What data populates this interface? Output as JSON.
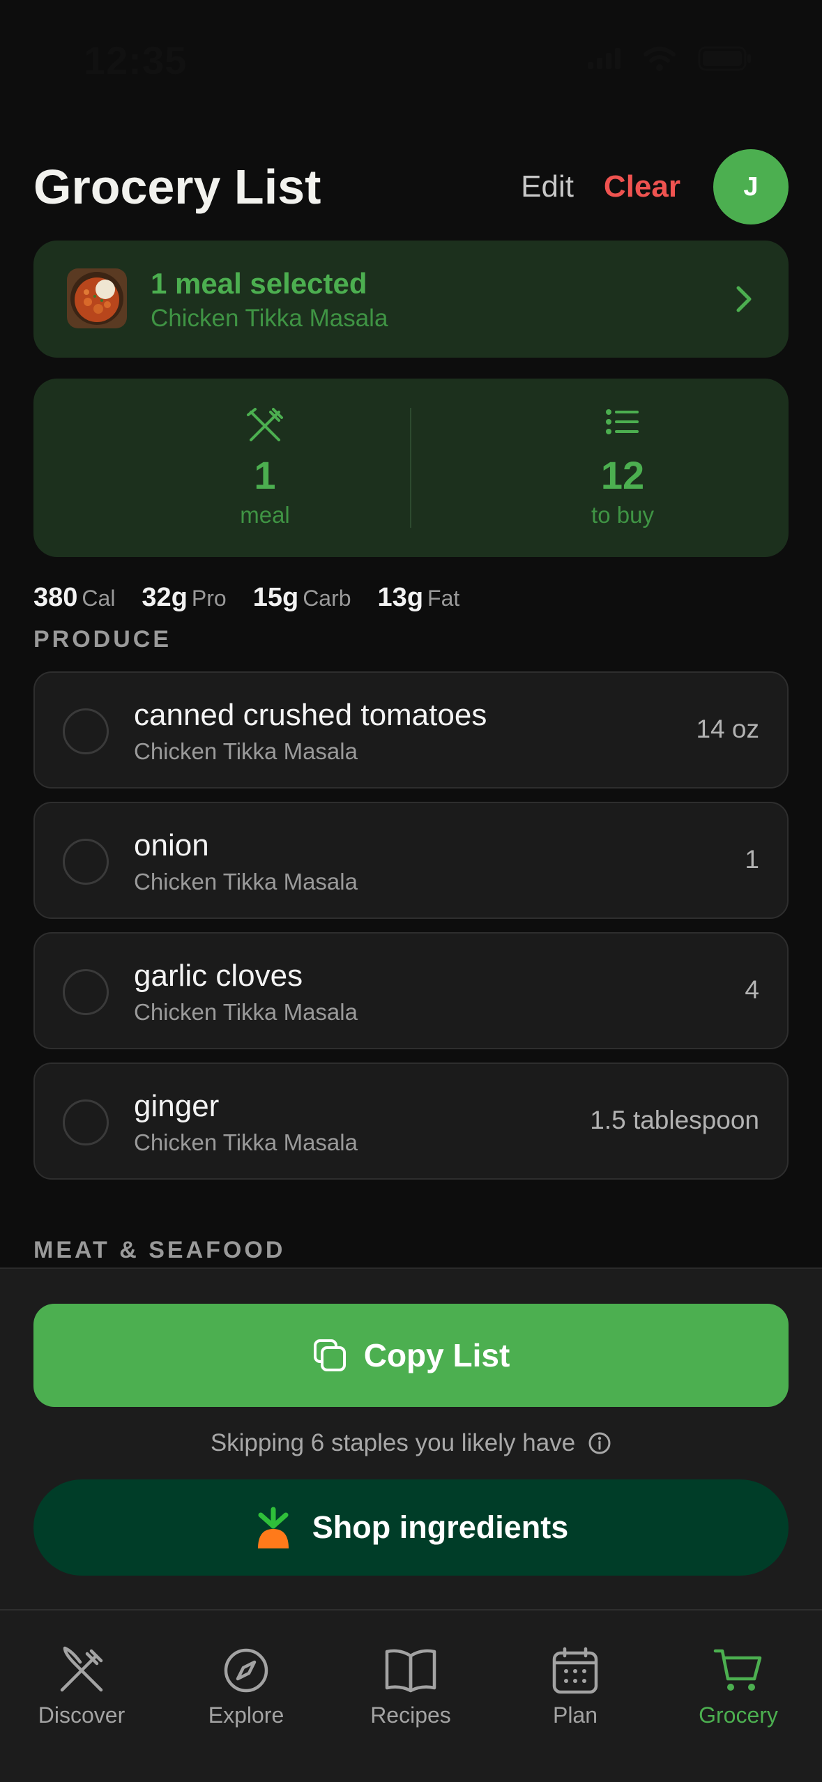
{
  "status_bar": {
    "time": "12:35"
  },
  "header": {
    "title": "Grocery List",
    "edit_label": "Edit",
    "clear_label": "Clear",
    "avatar_initial": "J"
  },
  "meal_selection": {
    "title": "1 meal selected",
    "meal_name": "Chicken Tikka Masala"
  },
  "stats": {
    "meals_value": "1",
    "meals_label": "meal",
    "to_buy_value": "12",
    "to_buy_label": "to buy"
  },
  "macros": [
    {
      "value": "380",
      "label": "Cal"
    },
    {
      "value": "32g",
      "label": "Pro"
    },
    {
      "value": "15g",
      "label": "Carb"
    },
    {
      "value": "13g",
      "label": "Fat"
    }
  ],
  "sections": [
    {
      "label": "PRODUCE",
      "items": [
        {
          "name": "canned crushed tomatoes",
          "recipe": "Chicken Tikka Masala",
          "quantity": "14 oz"
        },
        {
          "name": "onion",
          "recipe": "Chicken Tikka Masala",
          "quantity": "1"
        },
        {
          "name": "garlic cloves",
          "recipe": "Chicken Tikka Masala",
          "quantity": "4"
        },
        {
          "name": "ginger",
          "recipe": "Chicken Tikka Masala",
          "quantity": "1.5 tablespoon"
        }
      ]
    },
    {
      "label": "MEAT & SEAFOOD",
      "items": []
    }
  ],
  "actions": {
    "copy_label": "Copy List",
    "skip_note": "Skipping 6 staples you likely have",
    "shop_label": "Shop ingredients"
  },
  "tabs": [
    {
      "label": "Discover",
      "icon": "fork-knife-icon",
      "active": false
    },
    {
      "label": "Explore",
      "icon": "compass-icon",
      "active": false
    },
    {
      "label": "Recipes",
      "icon": "book-icon",
      "active": false
    },
    {
      "label": "Plan",
      "icon": "calendar-icon",
      "active": false
    },
    {
      "label": "Grocery",
      "icon": "cart-icon",
      "active": true
    }
  ],
  "colors": {
    "accent": "#4caf50",
    "danger": "#ef5350",
    "shop_button": "#003d28",
    "card": "#1c301d"
  }
}
